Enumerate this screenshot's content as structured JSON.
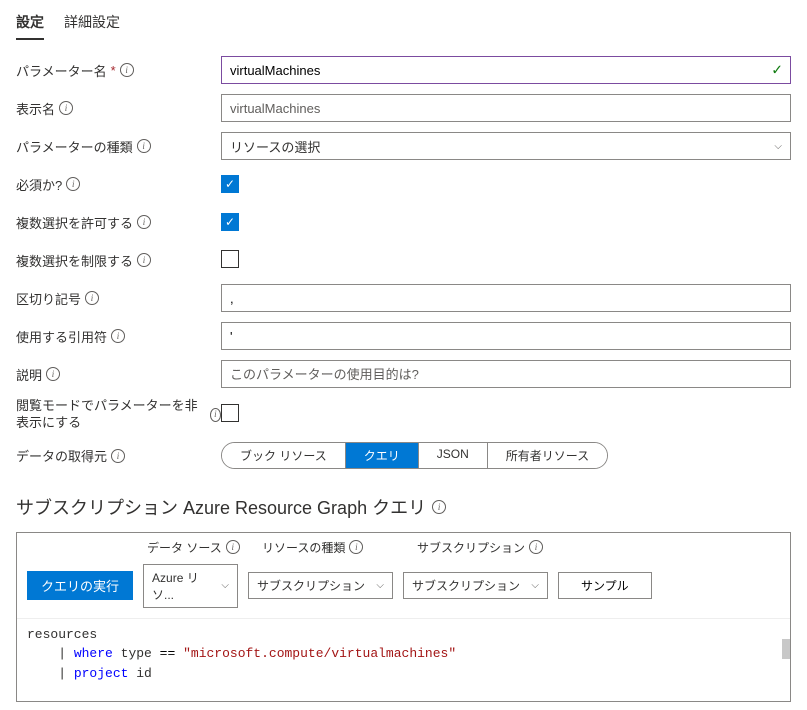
{
  "tabs": {
    "settings": "設定",
    "advanced": "詳細設定"
  },
  "fields": {
    "paramName": {
      "label": "パラメーター名",
      "value": "virtualMachines"
    },
    "displayName": {
      "label": "表示名",
      "placeholder": "virtualMachines"
    },
    "paramType": {
      "label": "パラメーターの種類",
      "value": "リソースの選択"
    },
    "required": {
      "label": "必須か?"
    },
    "allowMulti": {
      "label": "複数選択を許可する"
    },
    "limitMulti": {
      "label": "複数選択を制限する"
    },
    "delimiter": {
      "label": "区切り記号",
      "value": ","
    },
    "quote": {
      "label": "使用する引用符",
      "value": "'"
    },
    "description": {
      "label": "説明",
      "placeholder": "このパラメーターの使用目的は?"
    },
    "hideReader": {
      "label": "閲覧モードでパラメーターを非表示にする"
    },
    "dataFrom": {
      "label": "データの取得元"
    }
  },
  "pills": {
    "book": "ブック リソース",
    "query": "クエリ",
    "json": "JSON",
    "owner": "所有者リソース"
  },
  "section": {
    "title": "サブスクリプション Azure Resource Graph クエリ"
  },
  "toolbar": {
    "dataSourceLabel": "データ ソース",
    "resourceTypeLabel": "リソースの種類",
    "subscriptionLabel": "サブスクリプション",
    "run": "クエリの実行",
    "dataSource": "Azure リソ...",
    "resourceType": "サブスクリプション",
    "subscription": "サブスクリプション",
    "sample": "サンプル"
  },
  "code": {
    "l1": "resources",
    "l2_kw": "where",
    "l2_field": "type",
    "l2_op": "==",
    "l2_str": "\"microsoft.compute/virtualmachines\"",
    "l3_kw": "project",
    "l3_field": "id"
  }
}
